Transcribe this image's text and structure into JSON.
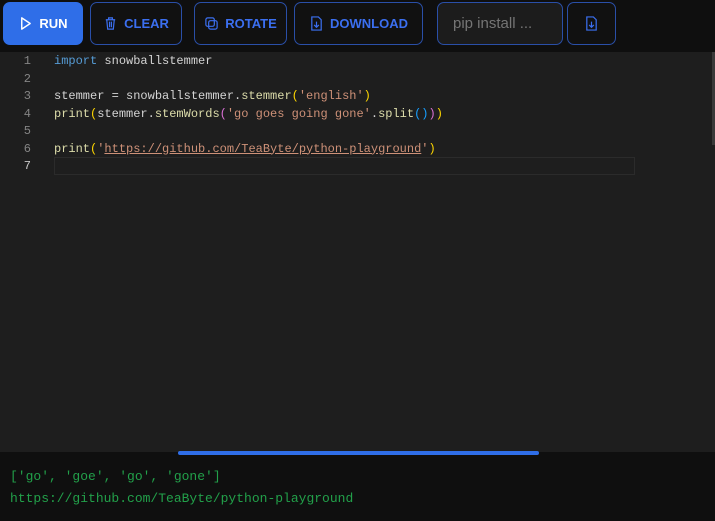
{
  "toolbar": {
    "run": "RUN",
    "clear": "CLEAR",
    "rotate": "ROTATE",
    "download": "DOWNLOAD",
    "pip_placeholder": "pip install ..."
  },
  "editor": {
    "line_numbers": [
      "1",
      "2",
      "3",
      "4",
      "5",
      "6",
      "7"
    ],
    "l1": {
      "kw": "import",
      "rest": " snowballstemmer"
    },
    "l3": {
      "a": "stemmer = snowballstemmer.",
      "fn": "stemmer",
      "p": "(",
      "s": "'english'",
      "pc": ")"
    },
    "l4": {
      "fn": "print",
      "p": "(",
      "a": "stemmer.",
      "fn2": "stemWords",
      "p2": "(",
      "s": "'go goes going gone'",
      "b": ".",
      "fn3": "split",
      "p3": "()",
      "p2c": ")",
      "pc": ")"
    },
    "l6": {
      "fn": "print",
      "p": "(",
      "q1": "'",
      "url": "https://github.com/TeaByte/python-playground",
      "q2": "'",
      "pc": ")"
    }
  },
  "output": {
    "lines": [
      "['go', 'goe', 'go', 'gone']",
      "https://github.com/TeaByte/python-playground"
    ]
  }
}
